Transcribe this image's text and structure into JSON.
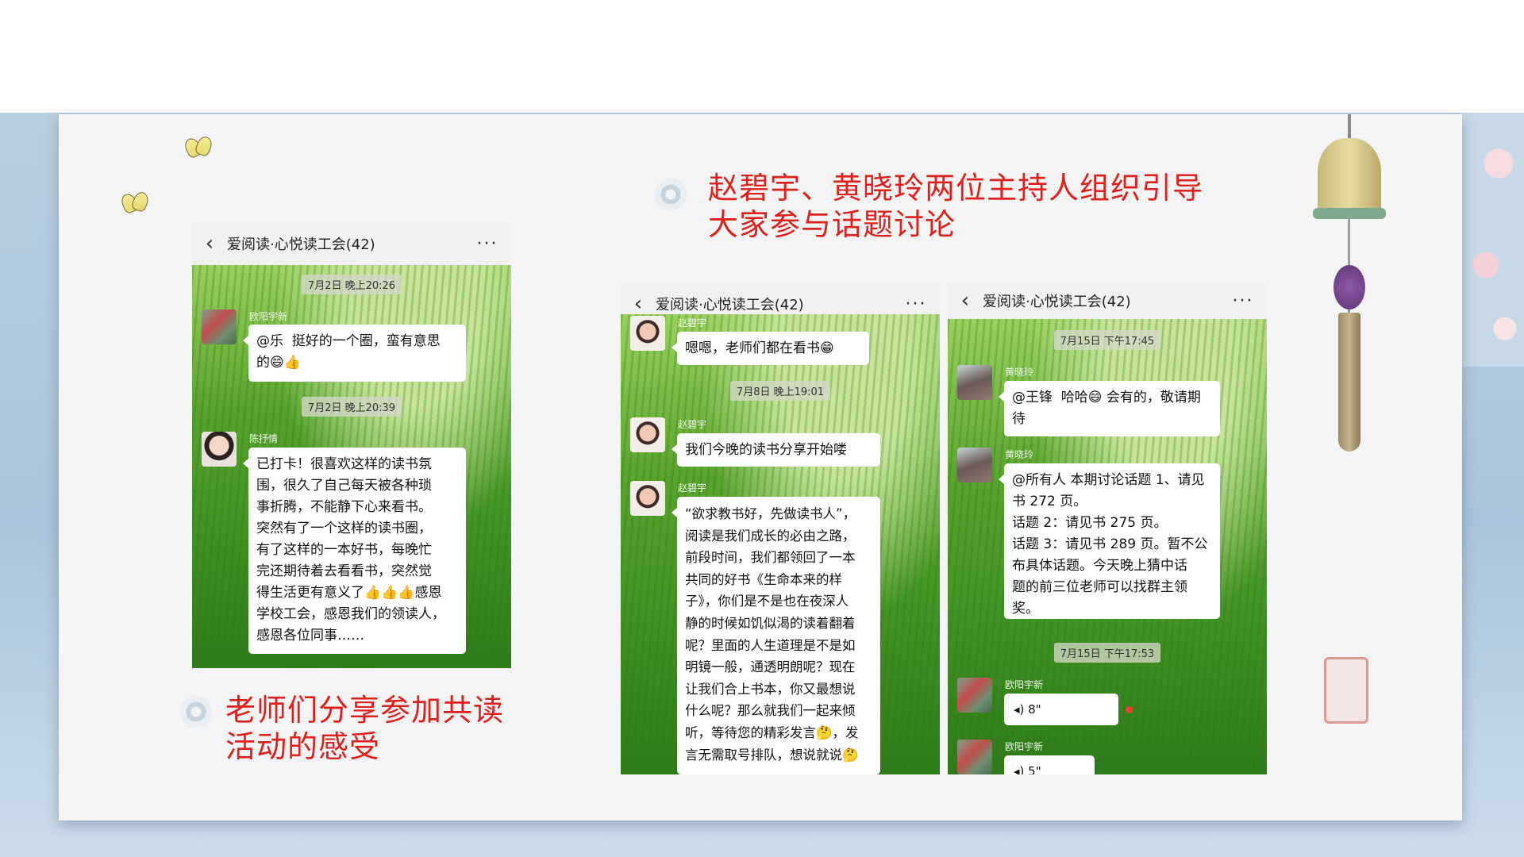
{
  "captions": {
    "top_right": [
      "赵碧宇、黄晓玲两位主持人组织引导",
      "大家参与话题讨论"
    ],
    "bottom_left": [
      "老师们分享参加共读",
      "活动的感受"
    ]
  },
  "chats": [
    {
      "title": "爱阅读·心悦读工会(42)",
      "messages": [
        {
          "time": "7月2日 晚上20:26"
        },
        {
          "sender": "欧阳宇新",
          "text": "@乐  挺好的一个圈，蛮有意思\n的😄👍"
        },
        {
          "time": "7月2日 晚上20:39"
        },
        {
          "sender": "陈抒情",
          "text": "已打卡！很喜欢这样的读书氛\n围，很久了自己每天被各种琐\n事折腾，不能静下心来看书。\n突然有了一个这样的读书圈，\n有了这样的一本好书，每晚忙\n完还期待着去看看书，突然觉\n得生活更有意义了👍👍👍感恩\n学校工会，感恩我们的领读人，\n感恩各位同事……"
        }
      ]
    },
    {
      "title": "爱阅读·心悦读工会(42)",
      "messages": [
        {
          "sender": "赵碧宇",
          "text": "嗯嗯，老师们都在看书😁"
        },
        {
          "time": "7月8日 晚上19:01"
        },
        {
          "sender": "赵碧宇",
          "text": "我们今晚的读书分享开始喽"
        },
        {
          "sender": "赵碧宇",
          "text": "“欲求教书好，先做读书人”，\n阅读是我们成长的必由之路，\n前段时间，我们都领回了一本\n共同的好书《生命本来的样\n子》，你们是不是也在夜深人\n静的时候如饥似渴的读着翻着\n呢？里面的人生道理是不是如\n明镜一般，通透明朗呢？现在\n让我们合上书本，你又最想说\n什么呢？那么就我们一起来倾\n听，等待您的精彩发言🤔，发\n言无需取号排队，想说就说🤔"
        }
      ]
    },
    {
      "title": "爱阅读·心悦读工会(42)",
      "messages": [
        {
          "time": "7月15日 下午17:45"
        },
        {
          "sender": "黄晓玲",
          "text": "@王锋  哈哈😄 会有的，敬请期\n待"
        },
        {
          "sender": "黄晓玲",
          "text": "@所有人 本期讨论话题 1、请见\n书 272 页。\n话题 2：请见书 275 页。\n话题 3：请见书 289 页。暂不公\n布具体话题。今天晚上猜中话\n题的前三位老师可以找群主领\n奖。"
        },
        {
          "time": "7月15日 下午17:53"
        },
        {
          "sender": "欧阳宇新",
          "voice": "8\""
        },
        {
          "sender": "欧阳宇新",
          "voice": "5\""
        }
      ]
    }
  ],
  "icons": {
    "back": "back-chevron-icon",
    "more": "more-dots-icon",
    "voice": "voice-wave-icon"
  },
  "colors": {
    "caption": "#e0201c",
    "header_bg": "#f1f1f1",
    "grass": "#4f9a2a"
  }
}
